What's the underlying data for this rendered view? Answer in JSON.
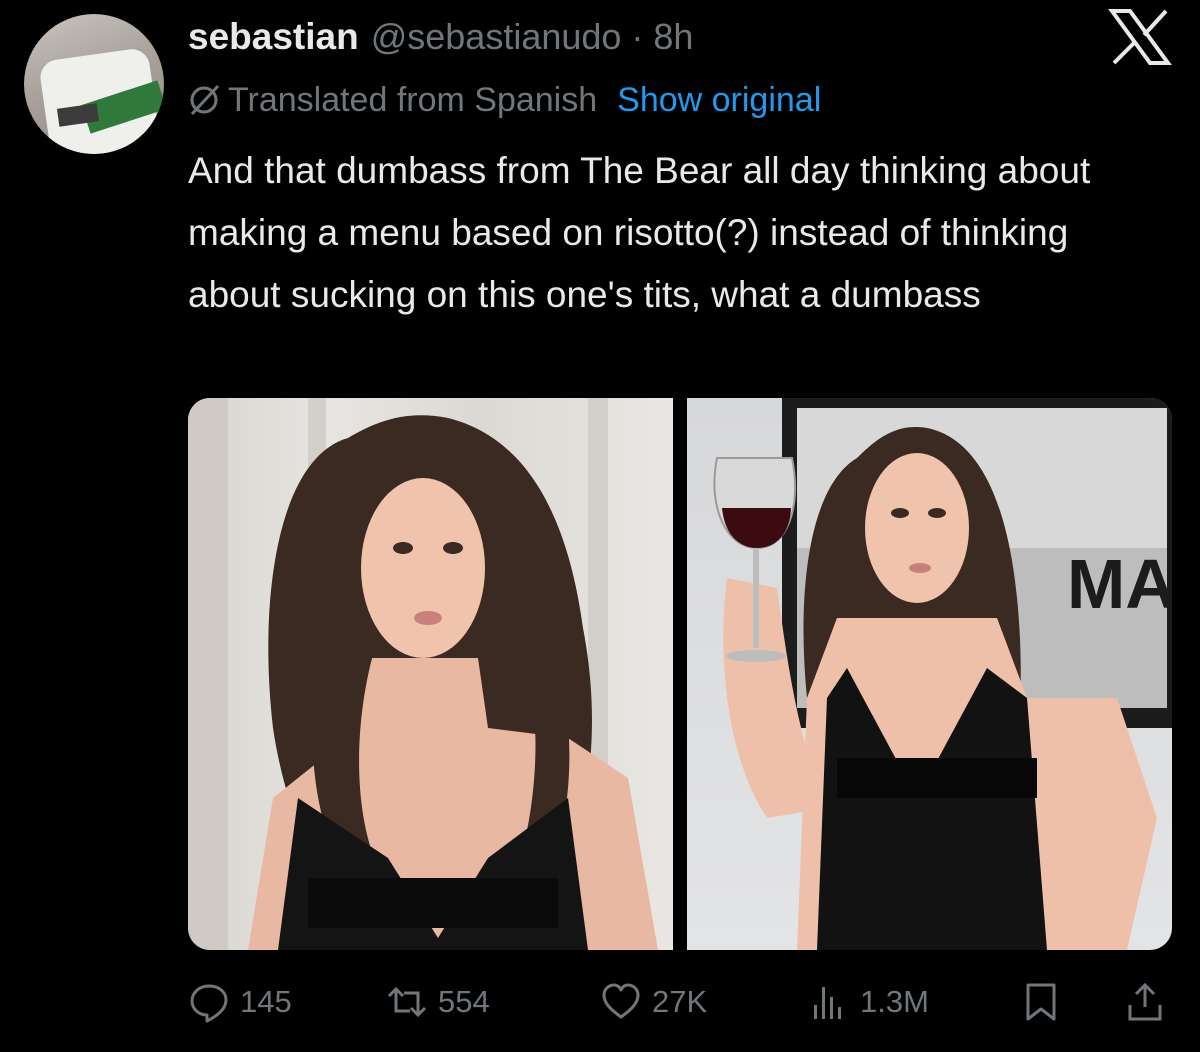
{
  "tweet": {
    "display_name": "sebastian",
    "handle_time": "@sebastianudo · 8h",
    "translated_label": "Translated from Spanish",
    "show_original_label": "Show original",
    "text": "And that dumbass from The Bear all day thinking about making a menu based on risotto(?) instead of thinking about sucking on this one's tits, what a dumbass",
    "photo_poster_text": "MAN"
  },
  "actions": {
    "replies": "145",
    "reposts": "554",
    "likes": "27K",
    "views": "1.3M"
  },
  "icons": [
    "x-logo-icon",
    "globe-slash-icon",
    "reply-icon",
    "repost-icon",
    "like-icon",
    "views-icon",
    "bookmark-icon",
    "share-icon"
  ],
  "colors": {
    "background": "#000000",
    "text": "#e7e9ea",
    "secondary": "#71767b",
    "link": "#1d9bf0"
  }
}
